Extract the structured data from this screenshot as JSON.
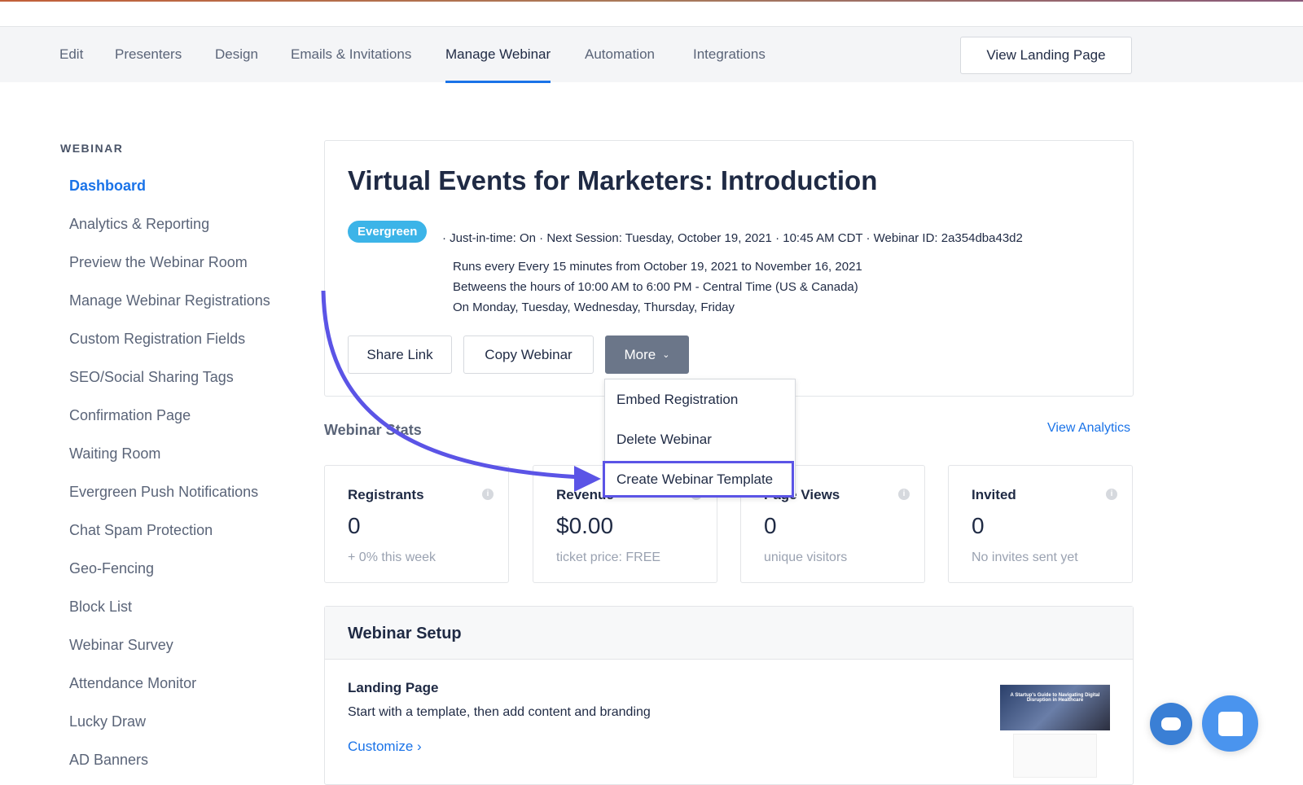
{
  "nav": {
    "tabs": [
      "Edit",
      "Presenters",
      "Design",
      "Emails & Invitations",
      "Manage Webinar",
      "Automation",
      "Integrations"
    ],
    "view_landing": "View Landing Page"
  },
  "sidebar": {
    "heading": "WEBINAR",
    "items": [
      "Dashboard",
      "Analytics & Reporting",
      "Preview the Webinar Room",
      "Manage Webinar Registrations",
      "Custom Registration Fields",
      "SEO/Social Sharing Tags",
      "Confirmation Page",
      "Waiting Room",
      "Evergreen Push Notifications",
      "Chat Spam Protection",
      "Geo-Fencing",
      "Block List",
      "Webinar Survey",
      "Attendance Monitor",
      "Lucky Draw",
      "AD Banners"
    ]
  },
  "webinar": {
    "title": "Virtual Events for Marketers: Introduction",
    "badge": "Evergreen",
    "meta": "· Just-in-time: On · Next Session: Tuesday, October 19, 2021 · 10:45 AM CDT · Webinar ID: 2a354dba43d2",
    "schedule": [
      "Runs every Every 15 minutes from October 19, 2021 to November 16, 2021",
      "Betweens the hours of 10:00 AM to 6:00 PM - Central Time (US & Canada)",
      "On Monday, Tuesday, Wednesday, Thursday, Friday"
    ],
    "share": "Share Link",
    "copy": "Copy Webinar",
    "more": "More"
  },
  "dropdown": [
    "Embed Registration",
    "Delete Webinar",
    "Create Webinar Template"
  ],
  "stats": {
    "heading": "Webinar Stats",
    "view_analytics": "View Analytics",
    "cards": [
      {
        "label": "Registrants",
        "value": "0",
        "sub": "+ 0% this week"
      },
      {
        "label": "Revenue",
        "value": "$0.00",
        "sub": "ticket price: FREE"
      },
      {
        "label": "Page Views",
        "value": "0",
        "sub": "unique visitors"
      },
      {
        "label": "Invited",
        "value": "0",
        "sub": "No invites sent yet"
      }
    ]
  },
  "setup": {
    "heading": "Webinar Setup",
    "lp_title": "Landing Page",
    "lp_desc": "Start with a template, then add content and branding",
    "customize": "Customize ›",
    "thumb_title": "A Startup's Guide to Navigating Digital Disruption in Healthcare"
  },
  "colors": {
    "accent": "#1a73e8",
    "highlight": "#5b54e6"
  }
}
